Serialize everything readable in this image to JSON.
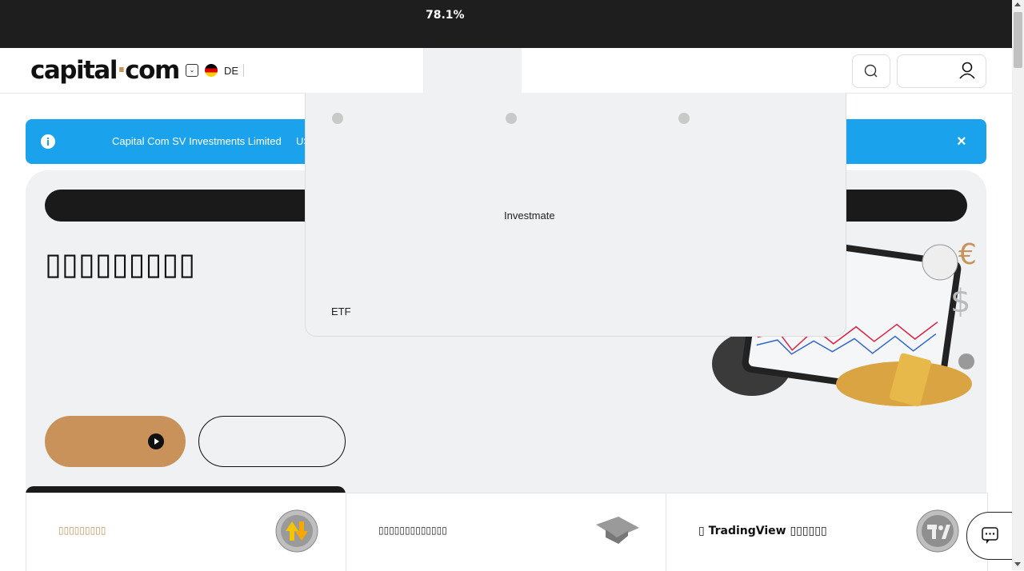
{
  "topbar": {
    "progress_text": "78.1%"
  },
  "header": {
    "logo_left": "capital",
    "logo_dot": "·",
    "logo_right": "com",
    "language": "DE"
  },
  "banner": {
    "text": "Capital Com SV Investments Limited",
    "text_cut": "US",
    "close": "×"
  },
  "hero": {
    "title": "▯▯▯▯▯▯▯▯▯"
  },
  "cards": [
    {
      "label": "▯▯▯▯▯▯▯▯▯"
    },
    {
      "label": "▯▯▯▯▯▯▯▯▯▯▯▯▯"
    },
    {
      "label": "▯ TradingView ▯▯▯▯▯▯"
    }
  ],
  "dropdown": {
    "item_investmate": "Investmate",
    "item_etf": "ETF"
  },
  "colors": {
    "accent": "#c9925a",
    "banner": "#1aa3ec",
    "dark": "#1a1a1a",
    "panel": "#f0f1f3"
  }
}
